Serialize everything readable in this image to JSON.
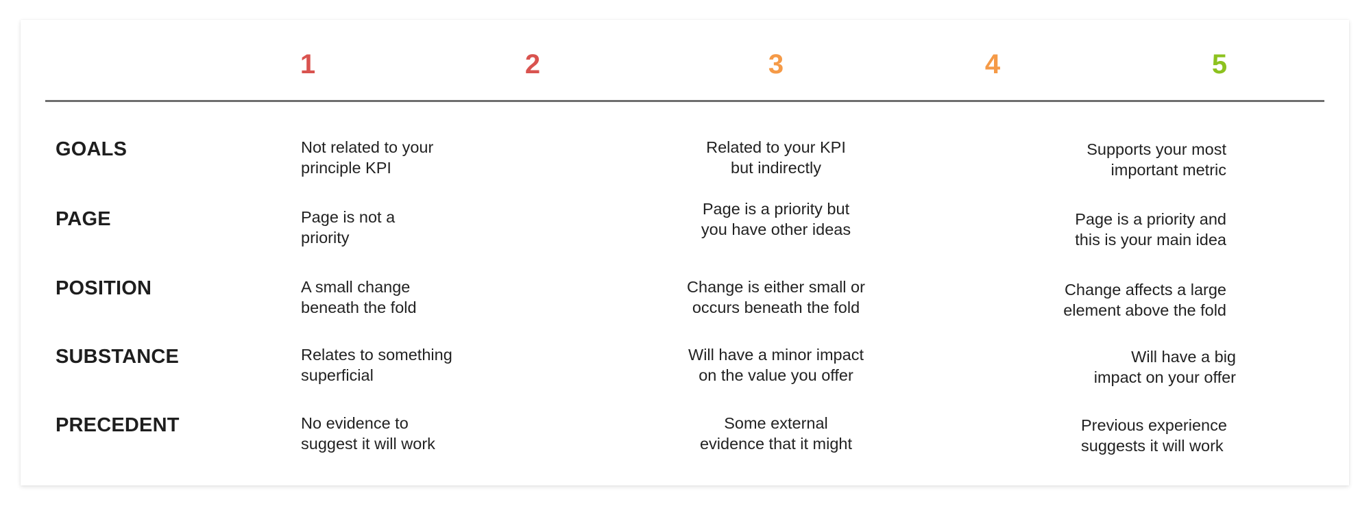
{
  "scale": {
    "scores": [
      {
        "value": "1",
        "color": "#D9534F"
      },
      {
        "value": "2",
        "color": "#D9534F"
      },
      {
        "value": "3",
        "color": "#F59A47"
      },
      {
        "value": "4",
        "color": "#F59A47"
      },
      {
        "value": "5",
        "color": "#8DC21F"
      }
    ]
  },
  "rows": [
    {
      "label": "GOALS",
      "score_1": "Not related to your\nprinciple KPI",
      "score_3": "Related to your KPI\nbut indirectly",
      "score_5": "Supports your most\nimportant metric"
    },
    {
      "label": "PAGE",
      "score_1": "Page is not a\npriority",
      "score_3": "Page is a priority but\nyou have other ideas",
      "score_5": "Page is a priority and\nthis is your main idea"
    },
    {
      "label": "POSITION",
      "score_1": "A small change\nbeneath the fold",
      "score_3": "Change is either small or\noccurs beneath the fold",
      "score_5": "Change affects a large\nelement above the fold"
    },
    {
      "label": "SUBSTANCE",
      "score_1": "Relates to something\nsuperficial",
      "score_3": "Will have a minor impact\non the value you offer",
      "score_5": "Will have a big\nimpact on your offer"
    },
    {
      "label": "PRECEDENT",
      "score_1": "No evidence to\nsuggest it will work",
      "score_3": "Some external\nevidence that it might",
      "score_5": "Previous experience\nsuggests it will work"
    }
  ]
}
